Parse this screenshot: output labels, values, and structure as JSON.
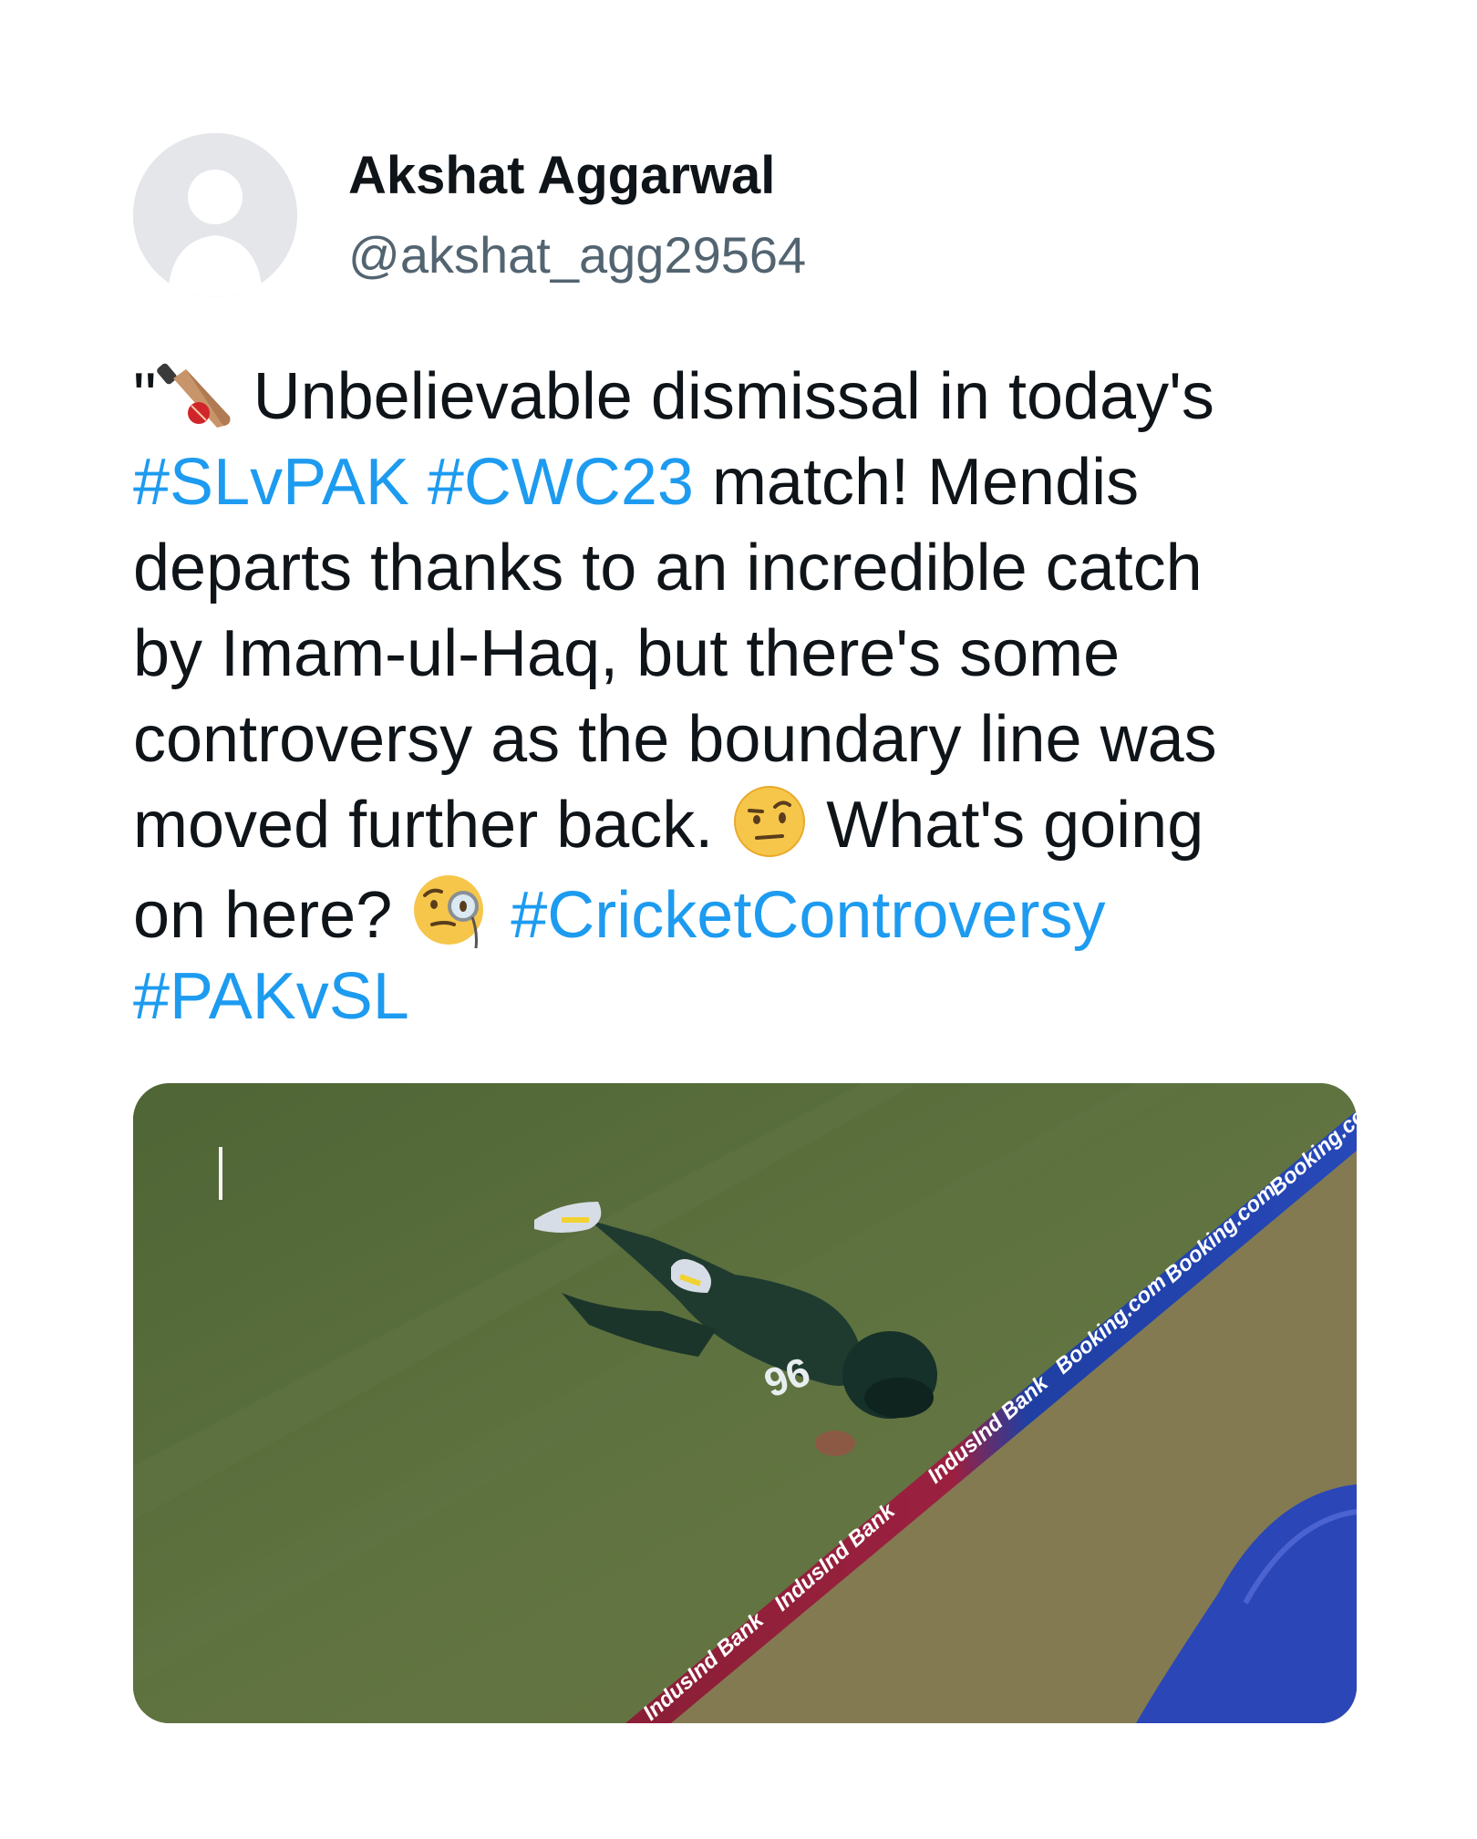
{
  "user": {
    "display_name": "Akshat Aggarwal",
    "handle": "@akshat_agg29564"
  },
  "tweet": {
    "line1_pre": "\"",
    "line1_text": " Unbelievable dismissal in today's",
    "line2_tag1": "#SLvPAK",
    "line2_tag2": "#CWC23",
    "line2_text": " match! Mendis",
    "line3_text": "departs thanks to an incredible catch",
    "line4_text": "by Imam-ul-Haq, but there's some",
    "line5_text": "controversy as the boundary line was",
    "line6_text1": "moved further back. ",
    "line6_text2": " What's going",
    "line7_text": "on here? ",
    "line7_tag": "#CricketControversy",
    "line8_tag": "#PAKvSL"
  },
  "emojis": [
    "cricket-bat-and-ball-icon",
    "face-with-raised-eyebrow-icon",
    "face-with-monocle-icon"
  ],
  "media": {
    "board_text_1": "IndusInd Bank",
    "board_text_2": "Booking.com",
    "jersey_number": "96"
  },
  "colors": {
    "hashtag": "#1d9bf0",
    "handle": "#536471",
    "text": "#0f1419",
    "grass": "#5d7040"
  }
}
